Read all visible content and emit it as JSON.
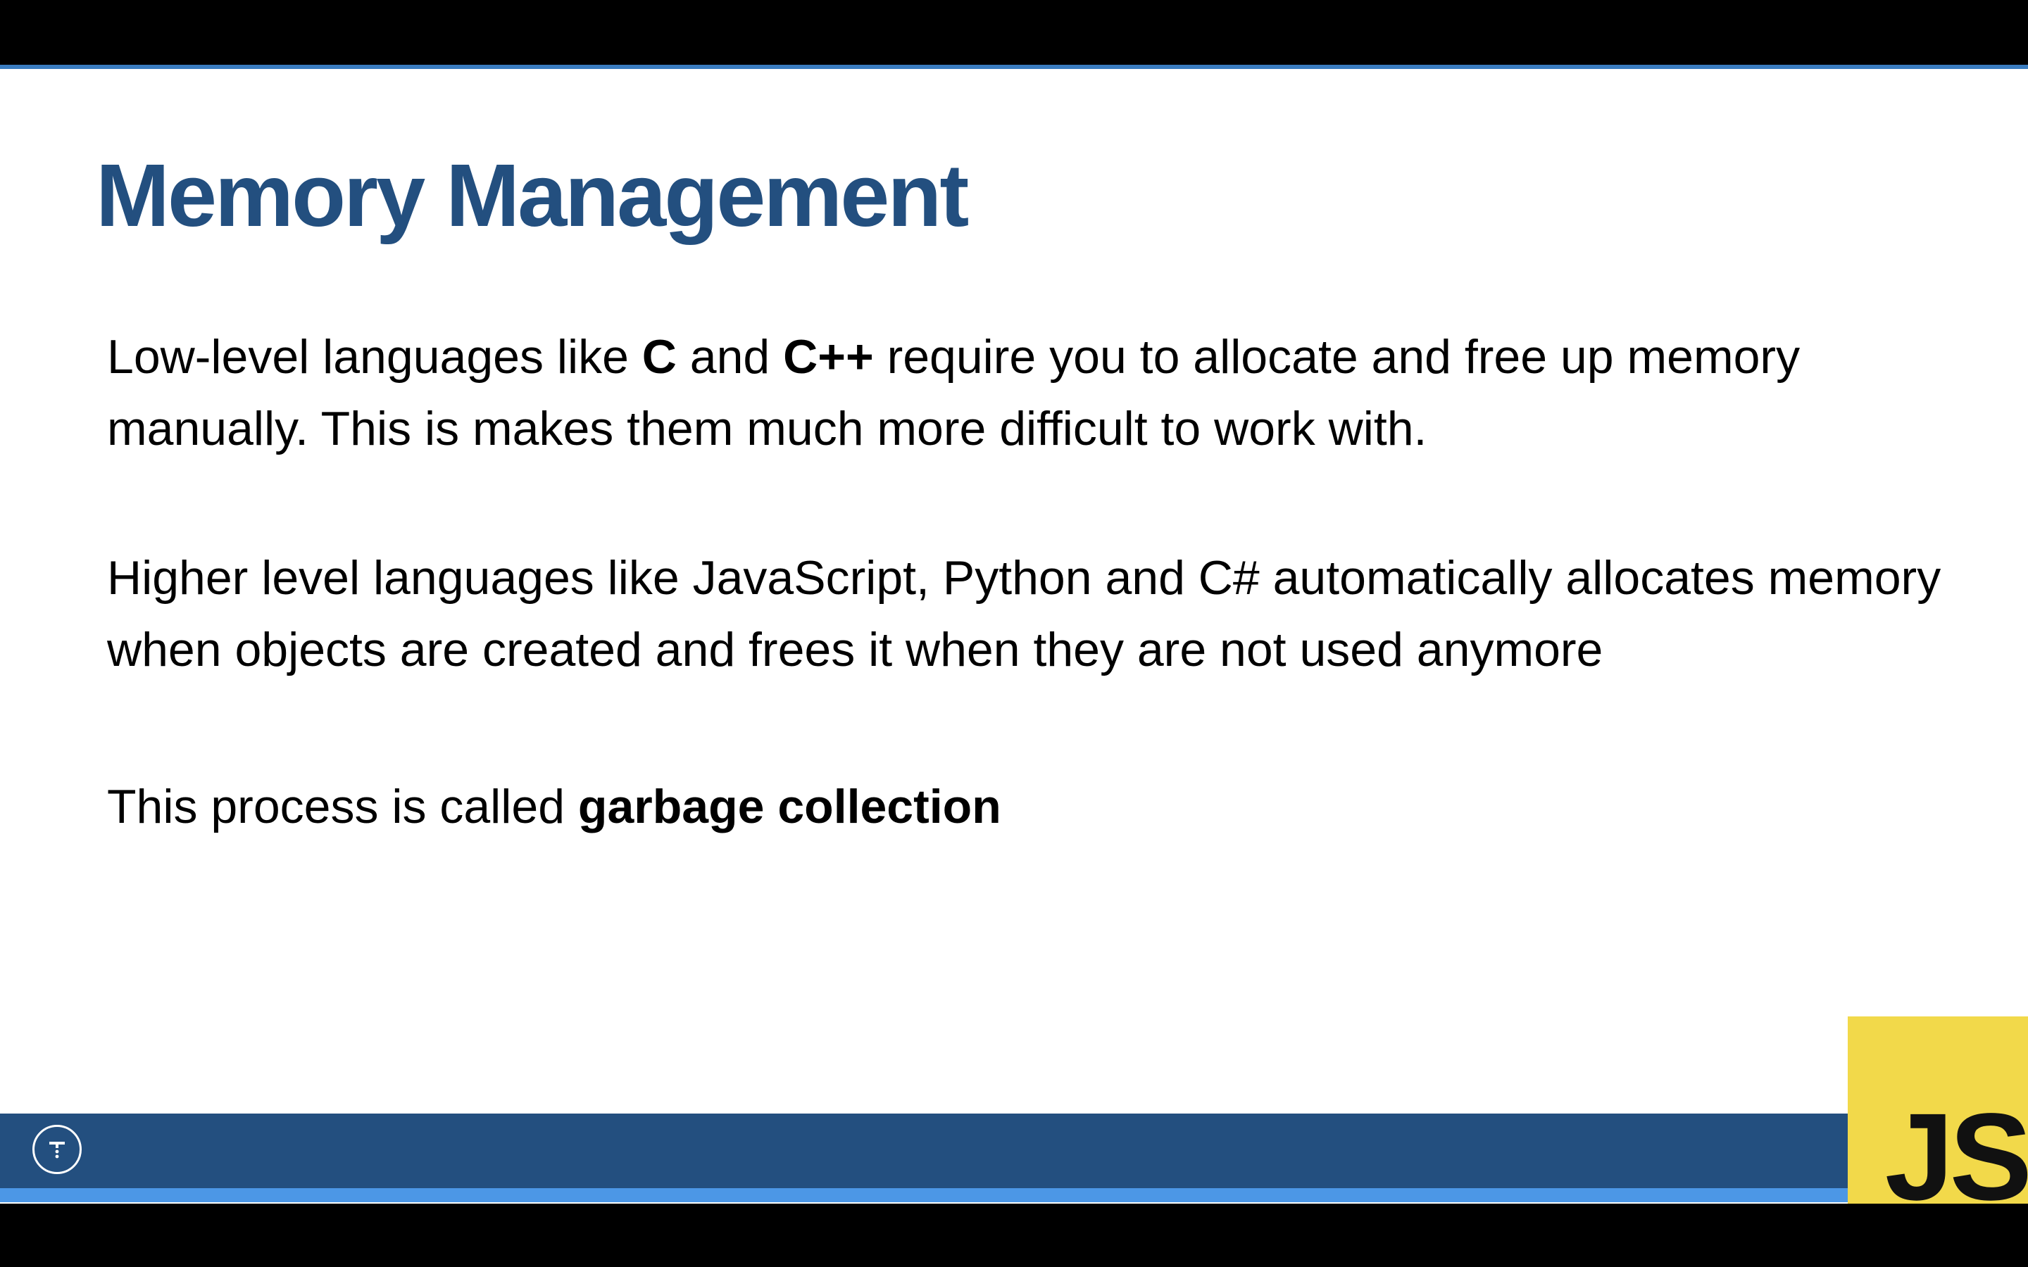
{
  "slide": {
    "title": "Memory Management",
    "paragraph_1": {
      "part_1": "Low-level languages like ",
      "bold_1": "C",
      "part_2": " and ",
      "bold_2": "C++",
      "part_3": " require you to allocate and free up memory manually. This is makes them much more difficult to work with."
    },
    "paragraph_2": "Higher level languages like JavaScript, Python and C# automatically allocates memory when objects are created and frees it when they are not used anymore",
    "paragraph_3": {
      "part_1": "This process is called ",
      "bold": "garbage collection"
    }
  },
  "footer": {
    "logo_icon": "t-circle-logo-icon",
    "js_badge_text": "JS"
  },
  "colors": {
    "title": "#234f7f",
    "band": "#234f7f",
    "stripe": "#4c97e6",
    "js_badge": "#f2d94a"
  }
}
